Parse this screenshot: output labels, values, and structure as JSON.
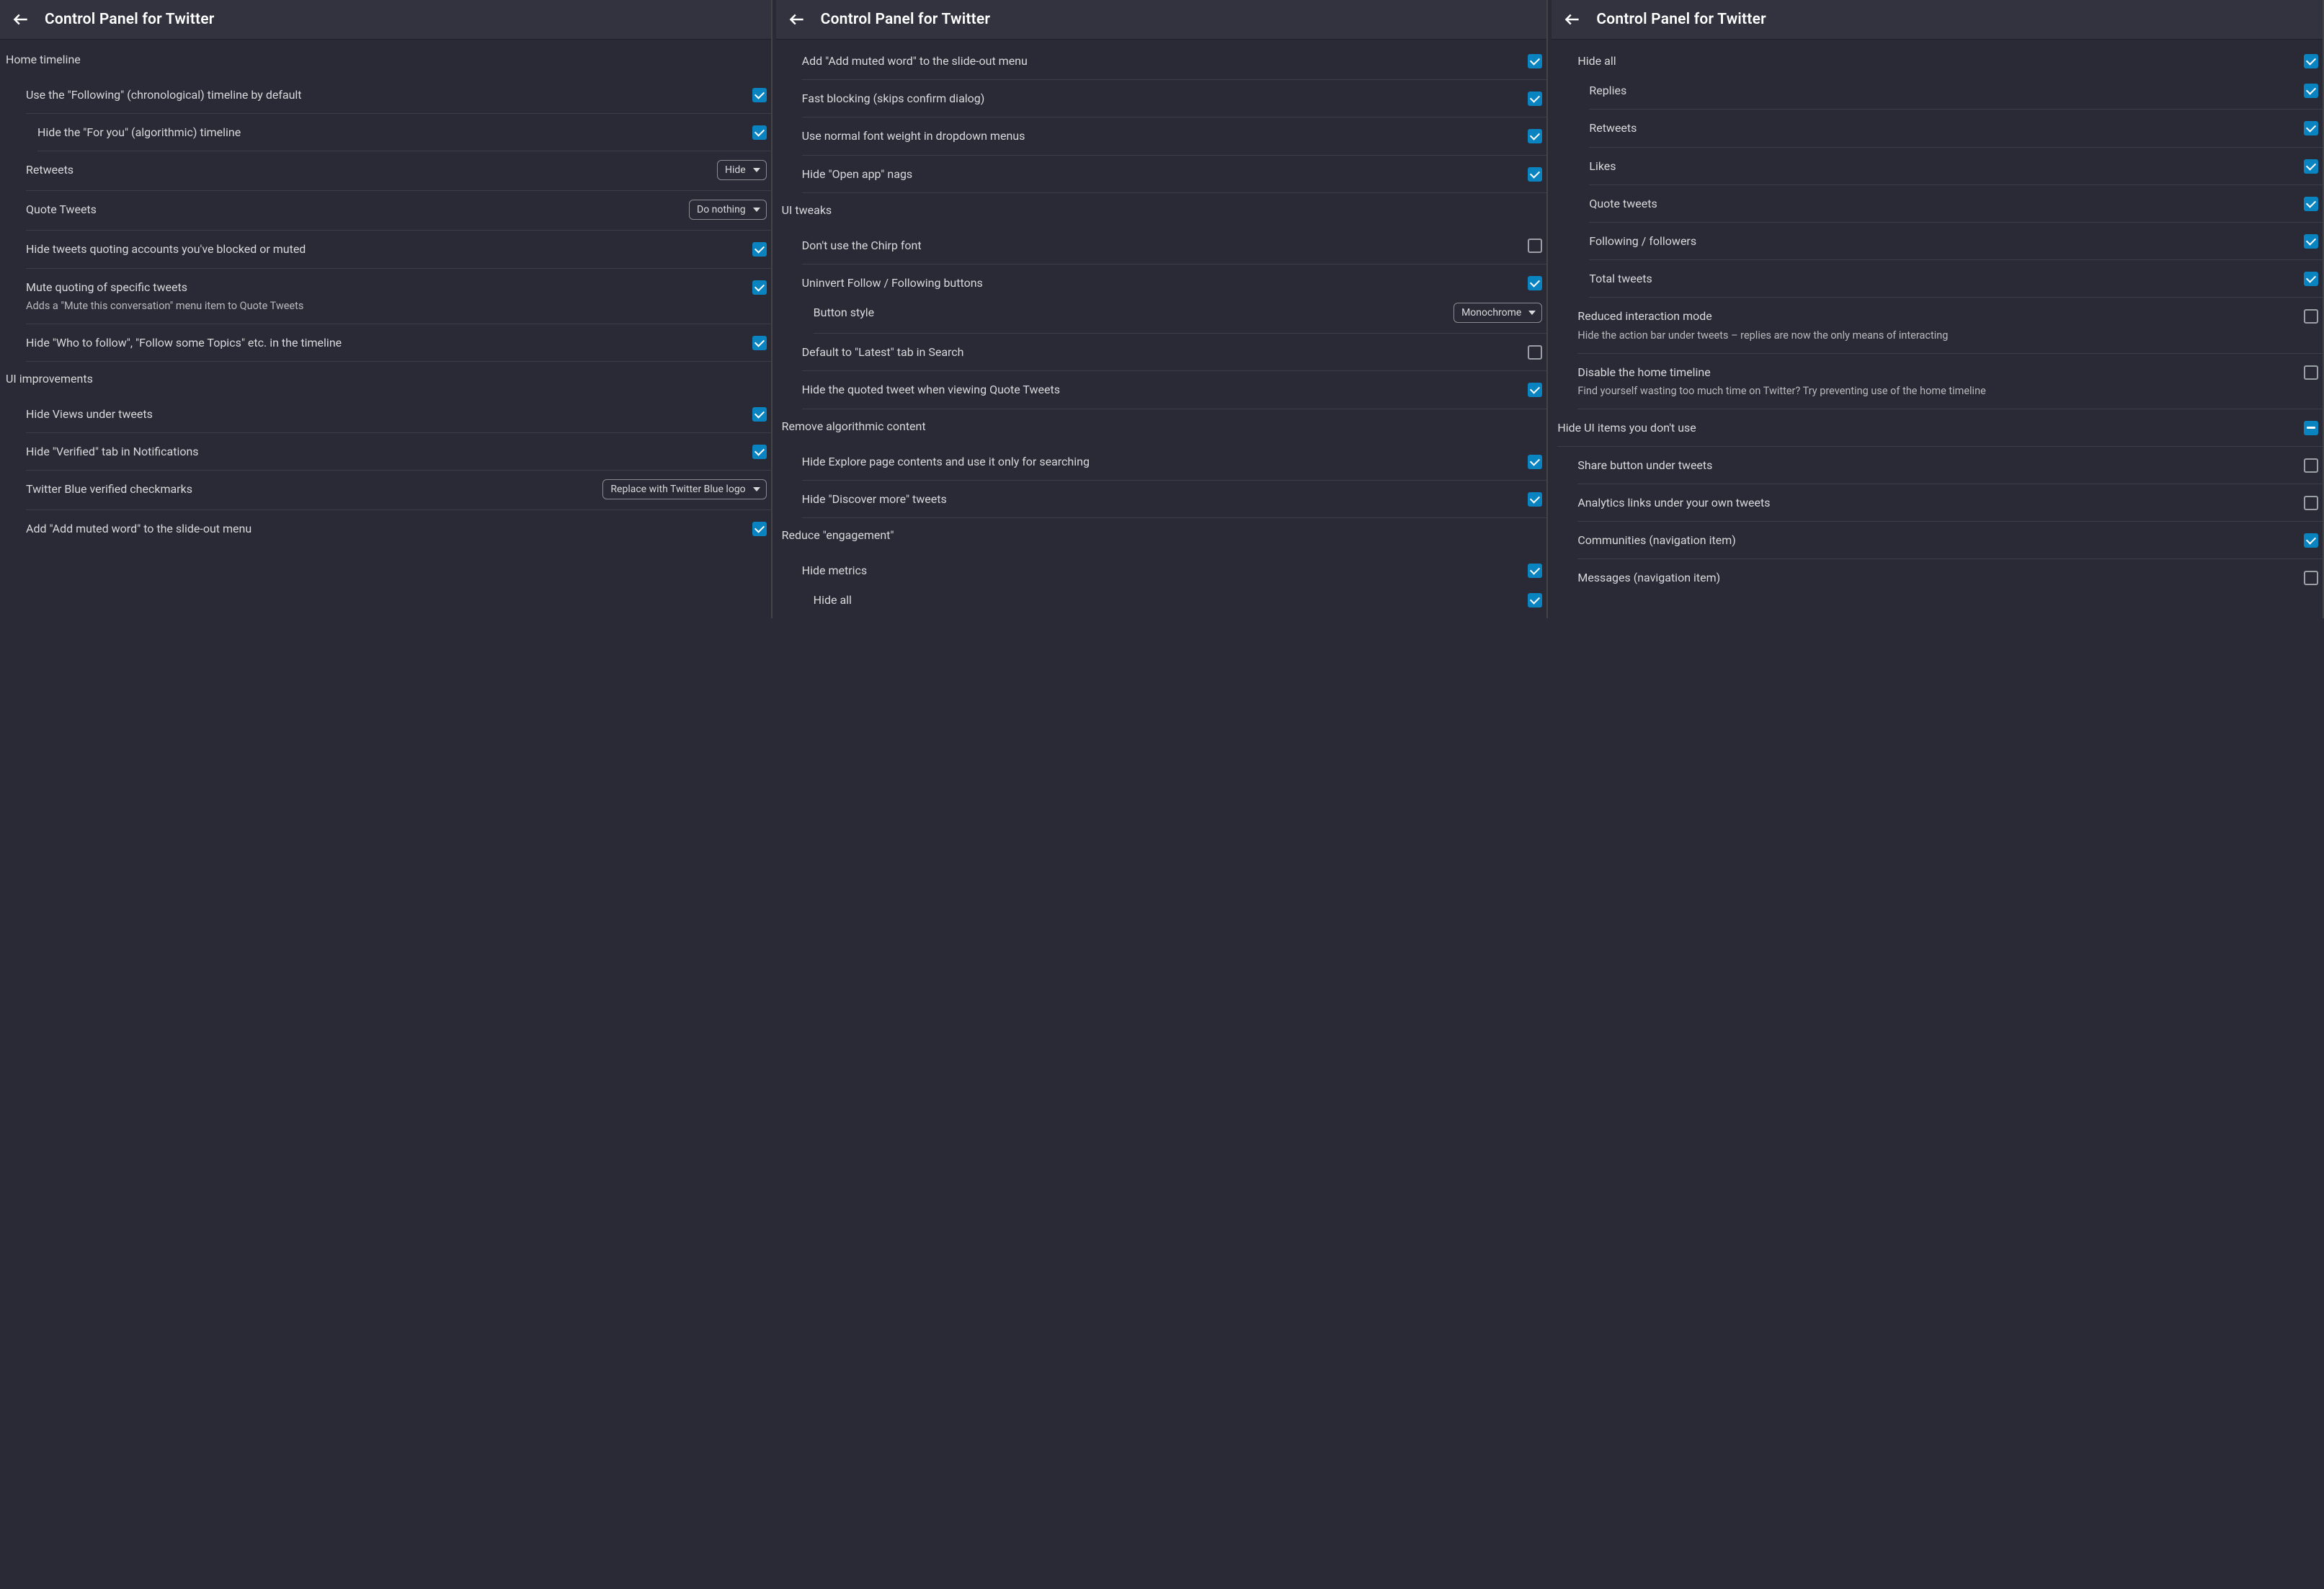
{
  "title": "Control Panel for Twitter",
  "panel1": {
    "sections": [
      {
        "title": "Home timeline",
        "rows": [
          {
            "label": "Use the \"Following\" (chronological) timeline by default",
            "ctrl": "check",
            "checked": true
          },
          {
            "label": "Hide the \"For you\" (algorithmic) timeline",
            "ctrl": "check",
            "checked": true,
            "indent": 1
          },
          {
            "label": "Retweets",
            "ctrl": "select",
            "value": "Hide"
          },
          {
            "label": "Quote Tweets",
            "ctrl": "select",
            "value": "Do nothing"
          },
          {
            "label": "Hide tweets quoting accounts you've blocked or muted",
            "ctrl": "check",
            "checked": true
          },
          {
            "label": "Mute quoting of specific tweets",
            "desc": "Adds a \"Mute this conversation\" menu item to Quote Tweets",
            "ctrl": "check",
            "checked": true
          },
          {
            "label": "Hide \"Who to follow\", \"Follow some Topics\" etc. in the timeline",
            "ctrl": "check",
            "checked": true
          }
        ]
      },
      {
        "title": "UI improvements",
        "rows": [
          {
            "label": "Hide Views under tweets",
            "ctrl": "check",
            "checked": true
          },
          {
            "label": "Hide \"Verified\" tab in Notifications",
            "ctrl": "check",
            "checked": true
          },
          {
            "label": "Twitter Blue verified checkmarks",
            "ctrl": "select",
            "value": "Replace with Twitter Blue logo"
          },
          {
            "label": "Add \"Add muted word\" to the slide-out menu",
            "ctrl": "check",
            "checked": true
          }
        ]
      }
    ]
  },
  "panel2": {
    "sections": [
      {
        "title": null,
        "rows": [
          {
            "label": "Add \"Add muted word\" to the slide-out menu",
            "ctrl": "check",
            "checked": true
          },
          {
            "label": "Fast blocking (skips confirm dialog)",
            "ctrl": "check",
            "checked": true
          },
          {
            "label": "Use normal font weight in dropdown menus",
            "ctrl": "check",
            "checked": true
          },
          {
            "label": "Hide \"Open app\" nags",
            "ctrl": "check",
            "checked": true
          }
        ]
      },
      {
        "title": "UI tweaks",
        "rows": [
          {
            "label": "Don't use the Chirp font",
            "ctrl": "check",
            "checked": false
          },
          {
            "label": "Uninvert Follow / Following buttons",
            "ctrl": "check",
            "checked": true,
            "no_border": true
          },
          {
            "label": "Button style",
            "ctrl": "select",
            "value": "Monochrome",
            "indent": 1
          },
          {
            "label": "Default to \"Latest\" tab in Search",
            "ctrl": "check",
            "checked": false
          },
          {
            "label": "Hide the quoted tweet when viewing Quote Tweets",
            "ctrl": "check",
            "checked": true
          }
        ]
      },
      {
        "title": "Remove algorithmic content",
        "rows": [
          {
            "label": "Hide Explore page contents and use it only for searching",
            "ctrl": "check",
            "checked": true
          },
          {
            "label": "Hide \"Discover more\" tweets",
            "ctrl": "check",
            "checked": true
          }
        ]
      },
      {
        "title": "Reduce \"engagement\"",
        "rows": [
          {
            "label": "Hide metrics",
            "ctrl": "check",
            "checked": true,
            "no_border": true
          },
          {
            "label": "Hide all",
            "ctrl": "check",
            "checked": true,
            "indent": 1
          }
        ]
      }
    ]
  },
  "panel3": {
    "sections": [
      {
        "title": null,
        "rows": [
          {
            "label": "Hide all",
            "ctrl": "check",
            "checked": true,
            "no_border": true
          },
          {
            "label": "Replies",
            "ctrl": "check",
            "checked": true,
            "indent": 1
          },
          {
            "label": "Retweets",
            "ctrl": "check",
            "checked": true,
            "indent": 1
          },
          {
            "label": "Likes",
            "ctrl": "check",
            "checked": true,
            "indent": 1
          },
          {
            "label": "Quote tweets",
            "ctrl": "check",
            "checked": true,
            "indent": 1
          },
          {
            "label": "Following / followers",
            "ctrl": "check",
            "checked": true,
            "indent": 1
          },
          {
            "label": "Total tweets",
            "ctrl": "check",
            "checked": true,
            "indent": 1
          },
          {
            "label": "Reduced interaction mode",
            "desc": "Hide the action bar under tweets – replies are now the only means of interacting",
            "ctrl": "check",
            "checked": false
          },
          {
            "label": "Disable the home timeline",
            "desc": "Find yourself wasting too much time on Twitter? Try preventing use of the home timeline",
            "ctrl": "check",
            "checked": false
          }
        ]
      },
      {
        "title_row": {
          "label": "Hide UI items you don't use",
          "ctrl": "check",
          "indeterminate": true
        },
        "rows": [
          {
            "label": "Share button under tweets",
            "ctrl": "check",
            "checked": false
          },
          {
            "label": "Analytics links under your own tweets",
            "ctrl": "check",
            "checked": false
          },
          {
            "label": "Communities (navigation item)",
            "ctrl": "check",
            "checked": true
          },
          {
            "label": "Messages (navigation item)",
            "ctrl": "check",
            "checked": false
          }
        ]
      }
    ]
  }
}
